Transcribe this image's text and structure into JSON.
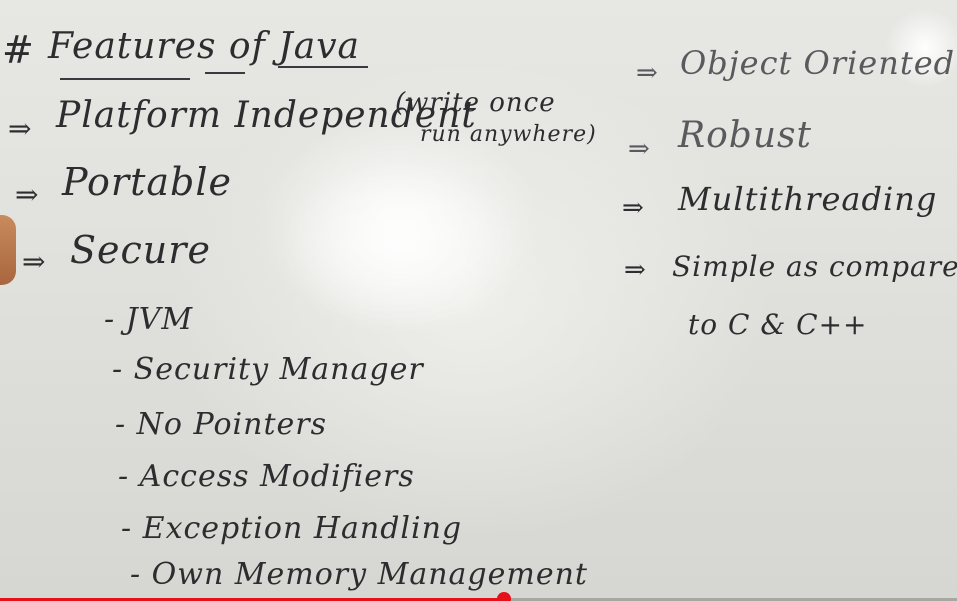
{
  "board": {
    "title_hash": "#",
    "title": "Features of Java",
    "left_items": [
      {
        "arrow": "⇒",
        "text": "Platform Independent"
      },
      {
        "arrow": "⇒",
        "text": "Portable"
      },
      {
        "arrow": "⇒",
        "text": "Secure"
      }
    ],
    "paren_line1": "(write once",
    "paren_line2": "run anywhere)",
    "secure_subitems": [
      "- JVM",
      "- Security Manager",
      "- No Pointers",
      "- Access Modifiers",
      "- Exception Handling",
      "- Own Memory Management"
    ],
    "right_items": [
      {
        "arrow": "⇒",
        "text": "Object Oriented"
      },
      {
        "arrow": "⇒",
        "text": "Robust"
      },
      {
        "arrow": "⇒",
        "text": "Multithreading"
      },
      {
        "arrow": "⇒",
        "text": "Simple as compared"
      }
    ],
    "right_continuation": "to C & C++"
  },
  "player": {
    "progress_fraction": 0.527,
    "accent_color": "#e5101a"
  }
}
